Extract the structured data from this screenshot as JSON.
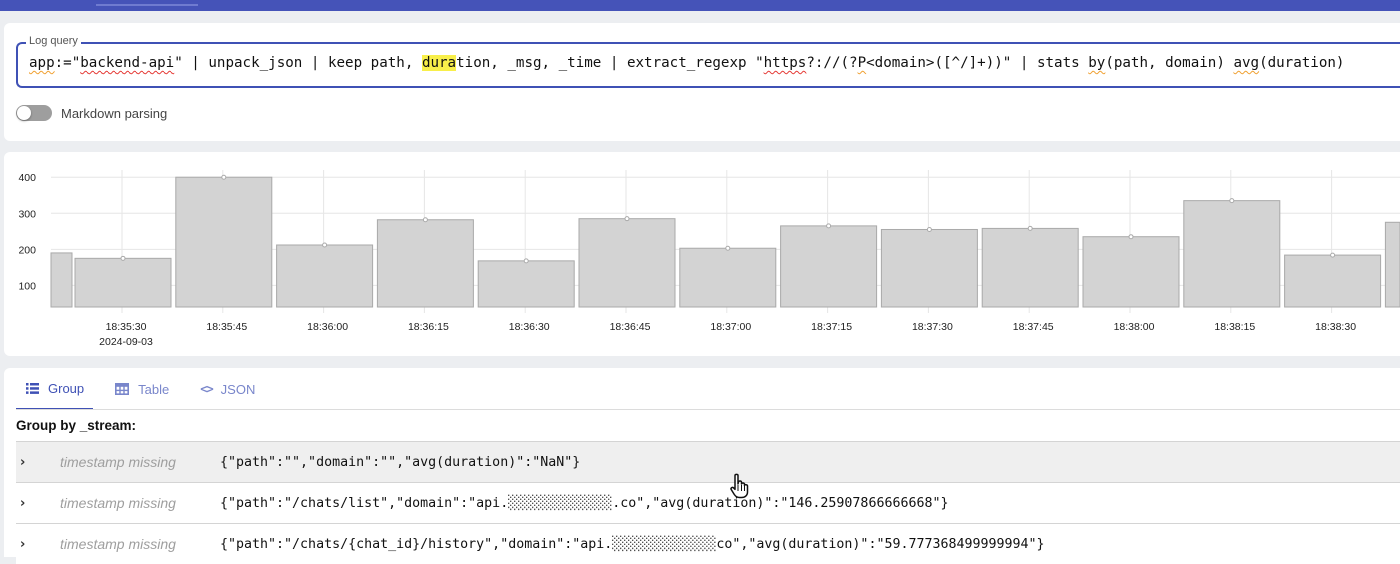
{
  "query": {
    "legend": "Log query",
    "segments": [
      {
        "text": "app",
        "style": "sq-org"
      },
      {
        "text": ":=\"",
        "style": ""
      },
      {
        "text": "backend-api",
        "style": "sq-red"
      },
      {
        "text": "\" | unpack_json | keep path, ",
        "style": ""
      },
      {
        "text": "dura",
        "style": "hl"
      },
      {
        "text": "tion, _msg, _time | extract_regexp \"",
        "style": ""
      },
      {
        "text": "https",
        "style": "sq-red"
      },
      {
        "text": "?://(?",
        "style": ""
      },
      {
        "text": "P",
        "style": "sq-org"
      },
      {
        "text": "<domain>([^/]+))\" | stats ",
        "style": ""
      },
      {
        "text": "by",
        "style": "sq-org"
      },
      {
        "text": "(path, domain) ",
        "style": ""
      },
      {
        "text": "avg",
        "style": "sq-org"
      },
      {
        "text": "(duration)",
        "style": ""
      }
    ]
  },
  "markdown_toggle": {
    "label": "Markdown parsing",
    "enabled": false
  },
  "chart_data": {
    "type": "bar",
    "y_ticks": [
      "100",
      "200",
      "300",
      "400"
    ],
    "ylim": [
      40,
      420
    ],
    "x_ticks": [
      "18:35:30",
      "18:35:45",
      "18:36:00",
      "18:36:15",
      "18:36:30",
      "18:36:45",
      "18:37:00",
      "18:37:15",
      "18:37:30",
      "18:37:45",
      "18:38:00",
      "18:38:15",
      "18:38:30"
    ],
    "x_date_label": "2024-09-03",
    "values": [
      190,
      175,
      400,
      212,
      282,
      168,
      285,
      203,
      265,
      255,
      258,
      235,
      335,
      184,
      275
    ],
    "bar_color": "#d3d3d3",
    "bar_border": "#a9a9a9",
    "grid": true
  },
  "tabs": [
    {
      "label": "Group",
      "icon": "list-icon",
      "active": true
    },
    {
      "label": "Table",
      "icon": "table-icon",
      "active": false
    },
    {
      "label": "JSON",
      "icon": "code-icon",
      "active": false
    }
  ],
  "group_heading": "Group by _stream:",
  "rows": [
    {
      "timestamp": "timestamp missing",
      "message": "{\"path\":\"\",\"domain\":\"\",\"avg(duration)\":\"NaN\"}"
    },
    {
      "timestamp": "timestamp missing",
      "message": "{\"path\":\"/chats/list\",\"domain\":\"api.░░░░░░░░░░░░░.co\",\"avg(duration)\":\"146.25907866666668\"}"
    },
    {
      "timestamp": "timestamp missing",
      "message": "{\"path\":\"/chats/{chat_id}/history\",\"domain\":\"api.░░░░░░░░░░░░░co\",\"avg(duration)\":\"59.777368499999994\"}"
    }
  ]
}
